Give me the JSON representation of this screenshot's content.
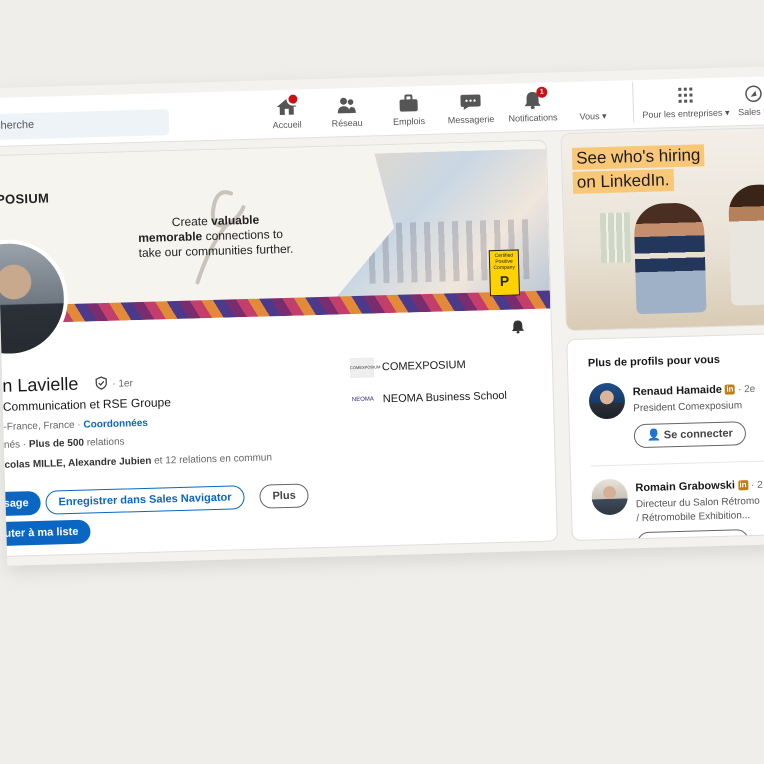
{
  "nav": {
    "search_placeholder": "cherche",
    "items": [
      {
        "label": "Accueil",
        "icon": "home-icon",
        "badge": ""
      },
      {
        "label": "Réseau",
        "icon": "network-icon",
        "badge": ""
      },
      {
        "label": "Emplois",
        "icon": "briefcase-icon",
        "badge": ""
      },
      {
        "label": "Messagerie",
        "icon": "message-icon",
        "badge": ""
      },
      {
        "label": "Notifications",
        "icon": "bell-icon",
        "badge": "1"
      },
      {
        "label": "Vous",
        "icon": "avatar-icon",
        "badge": ""
      }
    ],
    "business_label": "Pour les entreprises",
    "sales_label": "Sales N"
  },
  "banner": {
    "logo": "XPOSIUM",
    "tagline_1": "Create",
    "tagline_bold_1": "valuable",
    "tagline_bold_2": "memorable",
    "tagline_2": "connections to",
    "tagline_3": "take our communities further.",
    "certified_1": "Certified",
    "certified_2": "Positive",
    "certified_3": "Company",
    "certified_letter": "P"
  },
  "profile": {
    "name": "n Lavielle",
    "degree": "· 1er",
    "headline": "Communication et RSE Groupe",
    "location": "-France, France ·",
    "contact_link": "Coordonnées",
    "relations_prefix": "nés ·",
    "relations_count": "Plus de 500",
    "relations_suffix": "relations",
    "mutual_prefix": "colas MILLE, Alexandre Jubien",
    "mutual_suffix": "et 12 relations en commun",
    "companies": [
      {
        "name": "COMEXPOSIUM",
        "logo": "COMEXPOSIUM"
      },
      {
        "name": "NEOMA Business School",
        "logo": "NEOMA"
      }
    ],
    "buttons": {
      "message": "sage",
      "sales_nav": "Enregistrer dans Sales Navigator",
      "more": "Plus",
      "add_list": "uter à ma liste"
    }
  },
  "ad": {
    "line1": "See who's hiring",
    "line2": "on LinkedIn."
  },
  "suggestions": {
    "title": "Plus de profils pour vous",
    "people": [
      {
        "name": "Renaud Hamaide",
        "degree": "· 2e",
        "role_1": "President Comexposium",
        "role_2": "",
        "button": "Se connecter"
      },
      {
        "name": "Romain Grabowski",
        "degree": "· 2",
        "role_1": "Directeur du Salon Rétromo",
        "role_2": "/ Rétromobile Exhibition...",
        "button": ""
      }
    ]
  },
  "colors": {
    "brand": "#0a66c2",
    "badge": "#cc1016",
    "ad_highlight": "#f8c777"
  }
}
